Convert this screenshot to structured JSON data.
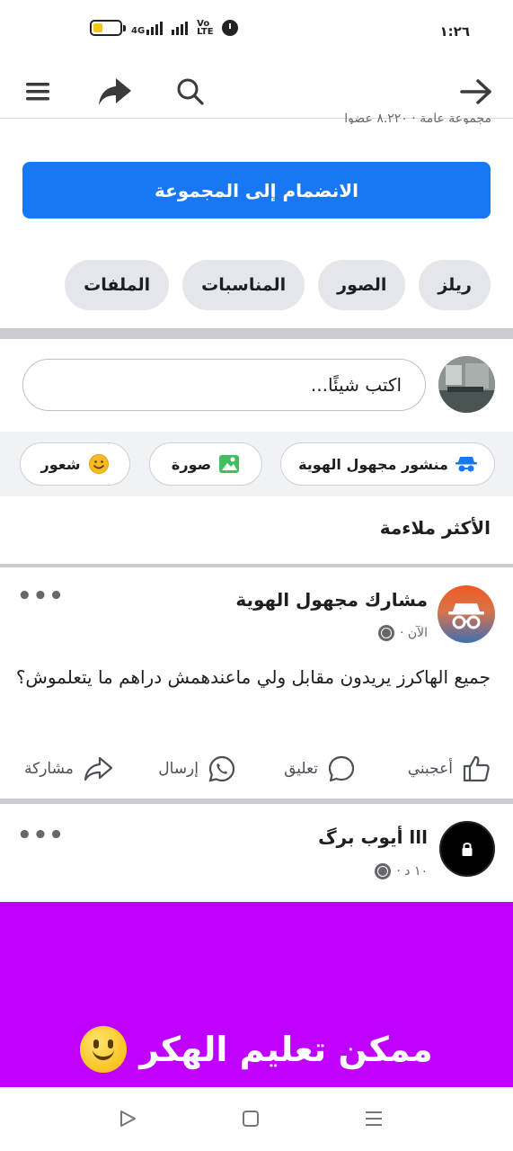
{
  "status_bar": {
    "time": "١:٢٦",
    "network_label": "4G",
    "volte_label": "Vo LTE",
    "battery_level": 0.35,
    "battery_color": "#f5c518"
  },
  "top_nav": {
    "icons": [
      "menu-icon",
      "share-icon",
      "search-icon",
      "back-arrow-icon"
    ],
    "overflow_text": "مجموعة عامة · ٨.٢٢٠ عضوا"
  },
  "group": {
    "join_label": "الانضمام إلى المجموعة",
    "accent_color": "#1877f2",
    "tabs": [
      "ريلز",
      "الصور",
      "المناسبات",
      "الملفات"
    ]
  },
  "composer": {
    "placeholder": "اكتب شيئًا...",
    "actions": {
      "anonymous": "منشور مجهول الهوية",
      "photo": "صورة",
      "feeling": "شعور"
    }
  },
  "feed": {
    "section_title": "الأكثر ملاءمة",
    "posts": [
      {
        "author": "مشارك مجهول الهوية",
        "time": "الآن ·",
        "text": "جميع الهاكرز يريدون مقابل ولي ماعندهمش دراهم ما يتعلموش؟"
      },
      {
        "author": "ااا أيوب برگ",
        "time": "١٠ د ·",
        "media_text": "ممكن تعليم الهكر",
        "media_color": "#c000ff"
      }
    ],
    "reactions": {
      "like": "أعجبني",
      "comment": "تعليق",
      "send": "إرسال",
      "share": "مشاركة"
    }
  },
  "system_nav": {
    "icons": [
      "back-triangle-icon",
      "home-square-icon",
      "recents-lines-icon"
    ]
  }
}
